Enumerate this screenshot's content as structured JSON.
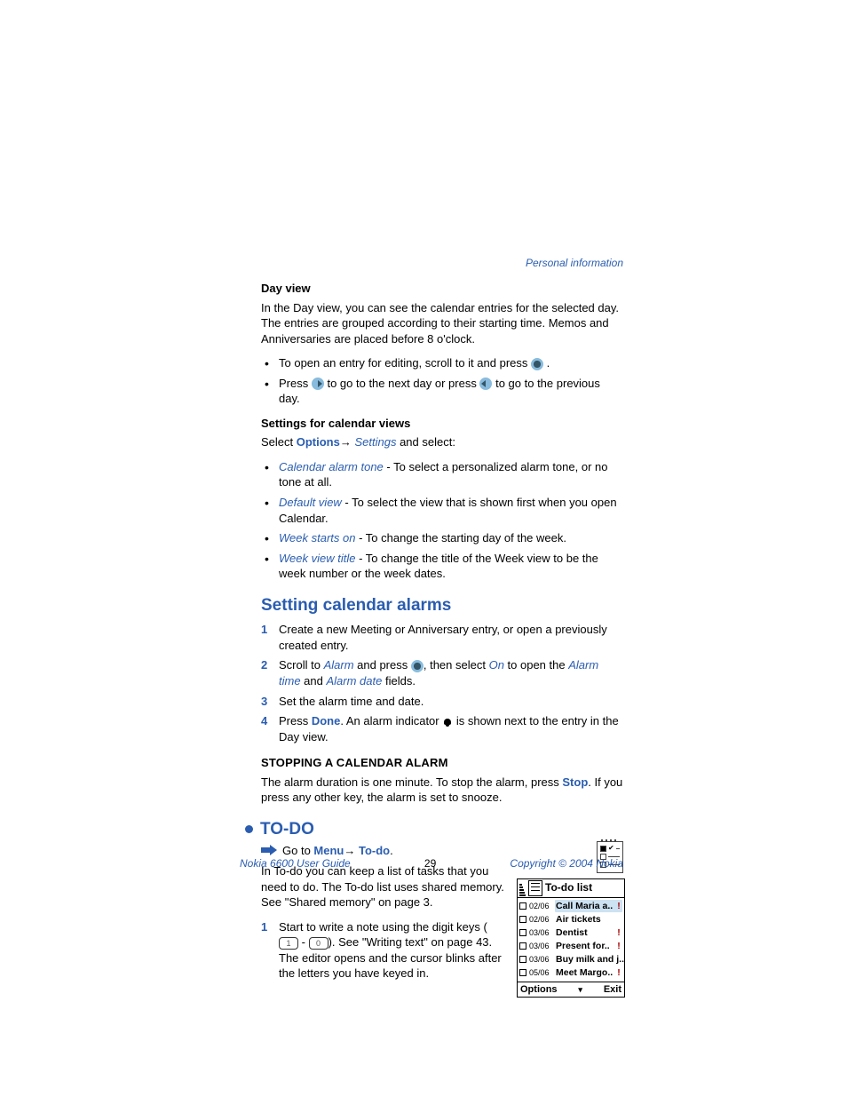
{
  "header_link": "Personal information",
  "day_view": {
    "title": "Day view",
    "para": "In the Day view, you can see the calendar entries for the selected day. The entries are grouped according to their starting time. Memos and Anniversaries are placed before 8 o'clock.",
    "bullet1": "To open an entry for editing, scroll to it and press ",
    "bullet1_end": ".",
    "bullet2_a": "Press ",
    "bullet2_b": " to go to the next day or press ",
    "bullet2_c": " to go to the previous day."
  },
  "settings": {
    "title": "Settings for calendar views",
    "lead_a": "Select ",
    "options": "Options",
    "arrow": "→",
    "settings_word": "Settings",
    "lead_b": " and select:",
    "items": [
      {
        "term": "Calendar alarm tone",
        "rest": " - To select a personalized alarm tone, or no tone at all."
      },
      {
        "term": "Default view",
        "rest": " - To select the view that is shown first when you open Calendar."
      },
      {
        "term": "Week starts on",
        "rest": " - To change the starting day of the week."
      },
      {
        "term": "Week view title",
        "rest": "  - To change the title of the Week view to be the week number or the week dates."
      }
    ]
  },
  "alarms": {
    "heading": "Setting calendar alarms",
    "steps": [
      {
        "n": "1",
        "text": "Create a new Meeting or Anniversary entry, or open a previously created entry."
      },
      {
        "n": "2",
        "t1": "Scroll to ",
        "alarm": "Alarm",
        "t2": " and press ",
        "t3": ", then select ",
        "on": "On",
        "t4": " to open the ",
        "alarm_time": "Alarm time",
        "t5": " and ",
        "alarm_date": "Alarm date",
        "t6": " fields."
      },
      {
        "n": "3",
        "text": "Set the alarm time and date."
      },
      {
        "n": "4",
        "t1": "Press ",
        "done": "Done",
        "t2": ". An alarm indicator ",
        "t3": " is shown next to the entry in the Day view."
      }
    ]
  },
  "stopping": {
    "heading": "STOPPING A CALENDAR ALARM",
    "t1": "The alarm duration is one minute. To stop the alarm, press ",
    "stop": "Stop",
    "t2": ". If you press any other key, the alarm is set to snooze."
  },
  "todo": {
    "heading": "TO-DO",
    "goto_a": "Go to ",
    "menu": "Menu",
    "arrow": "→",
    "todo_word": "To-do",
    "goto_b": ".",
    "para": "In To-do you can keep a list of tasks that you need to do. The To-do list uses shared memory. See \"Shared memory\" on page 3.",
    "step1_n": "1",
    "step1_a": "Start to write a note using the digit keys (",
    "key1": "1",
    "key_dash": " - ",
    "key0": "0",
    "step1_b": "). See \"Writing text\" on page 43. The editor opens and the cursor blinks after the letters you have keyed in."
  },
  "phone": {
    "title": "To-do list",
    "rows": [
      {
        "date": "02/06",
        "task": "Call Maria a..",
        "pri": "!",
        "selected": true
      },
      {
        "date": "02/06",
        "task": "Air tickets",
        "pri": ""
      },
      {
        "date": "03/06",
        "task": "Dentist",
        "pri": "!"
      },
      {
        "date": "03/06",
        "task": "Present for..",
        "pri": "!"
      },
      {
        "date": "03/06",
        "task": "Buy milk and j..",
        "pri": ""
      },
      {
        "date": "05/06",
        "task": "Meet Margo..",
        "pri": "!"
      }
    ],
    "left_soft": "Options",
    "mid_soft": "▾",
    "right_soft": "Exit"
  },
  "footer": {
    "left": "Nokia 6600 User Guide",
    "center": "29",
    "right": "Copyright © 2004 Nokia"
  }
}
